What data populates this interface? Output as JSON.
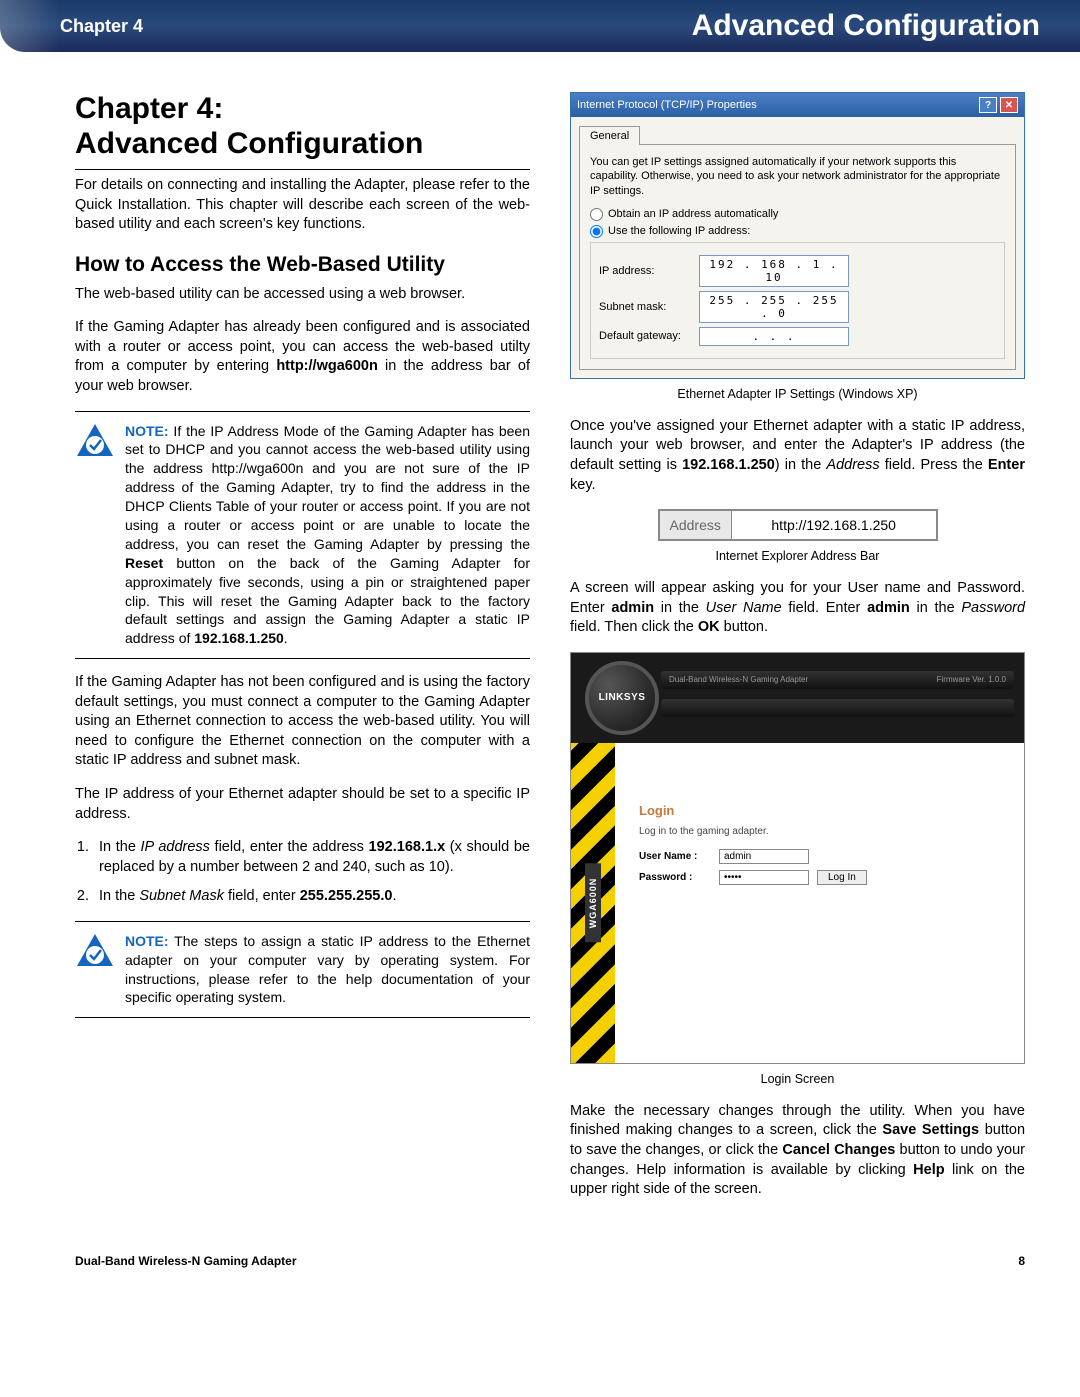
{
  "header": {
    "chapter_label": "Chapter 4",
    "section_title": "Advanced Configuration"
  },
  "left": {
    "title_line1": "Chapter 4:",
    "title_line2": "Advanced Configuration",
    "intro": "For details on connecting and installing the Adapter, please refer to the Quick Installation. This chapter will describe each screen of the web-based utility and each screen's key functions.",
    "subheading": "How to Access the Web-Based Utility",
    "p1": "The web-based utility can be accessed using a web browser.",
    "p2_pre": "If the Gaming Adapter has already been configured and is associated with a router or access point, you can access the web-based utilty from a computer by entering ",
    "p2_bold": "http://wga600n",
    "p2_post": " in the address bar of your web browser.",
    "note1_label": "NOTE:",
    "note1": " If the IP Address Mode of the Gaming Adapter has been set to DHCP and you cannot access the web-based utility using the address http://wga600n and you are not sure of the IP address of the Gaming Adapter, try to find the address in the DHCP Clients Table of your router or access point. If you are not using a router or access point or are unable to locate the address, you can reset the Gaming Adapter by pressing the ",
    "note1_reset": "Reset",
    "note1_b": " button on the back of the Gaming Adapter for approximately five seconds, using a pin or straightened paper clip. This will reset the Gaming Adapter back to the factory default settings and assign the Gaming Adapter a static IP address of ",
    "note1_ip": "192.168.1.250",
    "note1_end": ".",
    "p3": "If the Gaming Adapter has not been configured and is using the factory default settings, you must connect a computer to the Gaming Adapter using an Ethernet connection to access the web-based utility. You will need to configure the Ethernet connection on the computer with a static IP address and subnet mask.",
    "p4": "The IP address of your Ethernet adapter should be set to a specific IP address.",
    "li1_pre": "In the ",
    "li1_field": "IP address",
    "li1_mid": " field, enter the address ",
    "li1_ip": "192.168.1.x",
    "li1_post": " (x should be replaced by a number between 2 and 240, such as 10).",
    "li2_pre": "In the ",
    "li2_field": "Subnet Mask",
    "li2_mid": " field, enter ",
    "li2_mask": "255.255.255.0",
    "li2_end": ".",
    "note2_label": "NOTE:",
    "note2": " The steps to assign a static IP address to the Ethernet adapter on your computer vary by operating system. For instructions, please refer to the help documentation of your specific operating system."
  },
  "right": {
    "tcpip": {
      "title": "Internet Protocol (TCP/IP) Properties",
      "tab": "General",
      "desc": "You can get IP settings assigned automatically if your network supports this capability. Otherwise, you need to ask your network administrator for the appropriate IP settings.",
      "radio_auto": "Obtain an IP address automatically",
      "radio_use": "Use the following IP address:",
      "ip_label": "IP address:",
      "ip_val": "192 . 168 .   1  .  10",
      "subnet_label": "Subnet mask:",
      "subnet_val": "255 . 255 . 255 .   0",
      "gateway_label": "Default gateway:",
      "gateway_val": "   .       .      .   "
    },
    "caption1": "Ethernet Adapter IP Settings (Windows XP)",
    "p1_pre": "Once you've assigned your Ethernet adapter with a static IP address, launch your web browser, and enter the Adapter's IP address (the default setting is ",
    "p1_ip": "192.168.1.250",
    "p1_mid": ") in the ",
    "p1_addr": "Address",
    "p1_mid2": " field. Press the ",
    "p1_enter": "Enter",
    "p1_end": " key.",
    "addrbar": {
      "label": "Address",
      "value": "http://192.168.1.250"
    },
    "caption2": "Internet Explorer Address Bar",
    "p2_pre": "A screen will appear asking you for your User name and Password. Enter ",
    "p2_admin1": "admin",
    "p2_mid": " in the ",
    "p2_un": "User Name",
    "p2_mid2": " field. Enter ",
    "p2_admin2": "admin",
    "p2_mid3": " in the ",
    "p2_pw": "Password",
    "p2_mid4": " field. Then click the ",
    "p2_ok": "OK",
    "p2_end": " button.",
    "login": {
      "brand": "LINKSYS",
      "topbar": "Dual-Band Wireless-N Gaming Adapter",
      "fw": "Firmware Ver. 1.0.0",
      "side_model": "WGA600N",
      "heading": "Login",
      "sub": "Log in to the gaming adapter.",
      "un_label": "User Name :",
      "un_val": "admin",
      "pw_label": "Password :",
      "pw_val": "•••••",
      "btn": "Log In"
    },
    "caption3": "Login Screen",
    "p3_pre": "Make the necessary changes through the utility. When you have finished making changes to a screen, click the ",
    "p3_save": "Save Settings",
    "p3_mid": " button to save the changes, or click the ",
    "p3_cancel": "Cancel Changes",
    "p3_mid2": " button to undo your changes. Help information is available by clicking ",
    "p3_help": "Help",
    "p3_end": " link on the upper right side of the screen."
  },
  "footer": {
    "product": "Dual-Band Wireless-N Gaming Adapter",
    "page": "8"
  }
}
